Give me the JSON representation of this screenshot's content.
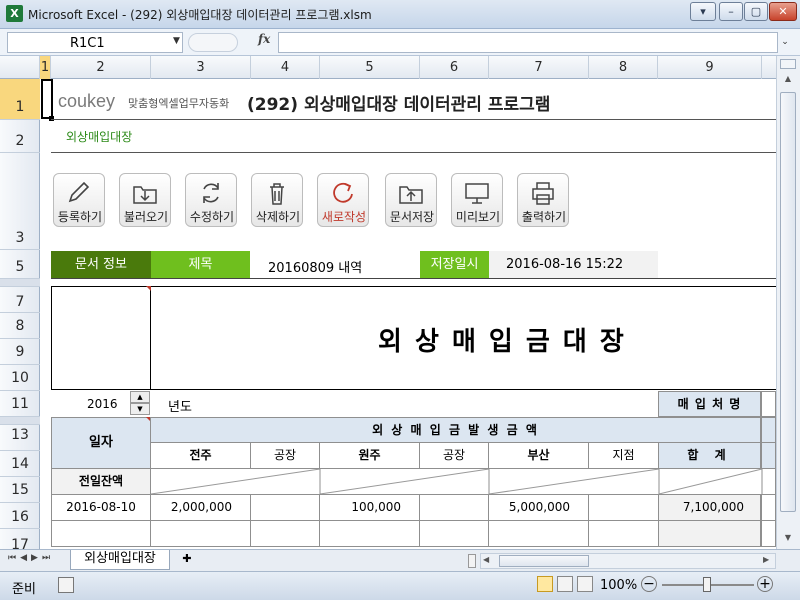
{
  "window": {
    "title": "Microsoft Excel - (292) 외상매입대장 데이터관리 프로그램.xlsm",
    "app_icon": "X"
  },
  "formula_bar": {
    "name_box": "R1C1",
    "fx_label": "fx",
    "formula": ""
  },
  "columns": [
    "1",
    "2",
    "3",
    "4",
    "5",
    "6",
    "7",
    "8",
    "9"
  ],
  "rows": [
    "1",
    "2",
    "3",
    "5",
    "7",
    "8",
    "9",
    "10",
    "11",
    "13",
    "14",
    "15",
    "16",
    "17"
  ],
  "header": {
    "logo": "coukey",
    "tagline": "맞춤형엑셀업무자동화",
    "title": "(292) 외상매입대장 데이터관리 프로그램",
    "subtitle": "외상매입대장"
  },
  "toolbar": [
    {
      "label": "등록하기",
      "icon": "pencil-icon"
    },
    {
      "label": "불러오기",
      "icon": "folder-open-icon"
    },
    {
      "label": "수정하기",
      "icon": "refresh-icon"
    },
    {
      "label": "삭제하기",
      "icon": "trash-icon"
    },
    {
      "label": "새로작성",
      "icon": "new-circle-icon"
    },
    {
      "label": "문서저장",
      "icon": "folder-save-icon"
    },
    {
      "label": "미리보기",
      "icon": "monitor-icon"
    },
    {
      "label": "출력하기",
      "icon": "printer-icon"
    }
  ],
  "docinfo": {
    "info_label": "문서 정보",
    "title_label": "제목",
    "title_value": "20160809 내역",
    "saved_label": "저장일시",
    "saved_value": "2016-08-16 15:22"
  },
  "ledger": {
    "main_title": "외 상 매 입 금 대 장",
    "year": "2016",
    "year_label": "년도",
    "vendor_label": "매 입 처 명",
    "date_header": "일자",
    "occur_header": "외 상 매 입 금 발 생 금 액",
    "sub_headers": [
      "전주",
      "공장",
      "원주",
      "공장",
      "부산",
      "지점",
      "합 계"
    ],
    "carry_label": "전일잔액",
    "row_date": "2016-08-10",
    "row_values": [
      "2,000,000",
      "",
      "100,000",
      "",
      "5,000,000",
      "",
      "7,100,000"
    ]
  },
  "sheet_tab": "외상매입대장",
  "status": {
    "ready": "준비",
    "zoom": "100%"
  },
  "colors": {
    "dark_green": "#4a7a0c",
    "lime": "#6fbf1e",
    "header_blue": "#dce6f1",
    "new_red": "#c0392b"
  }
}
